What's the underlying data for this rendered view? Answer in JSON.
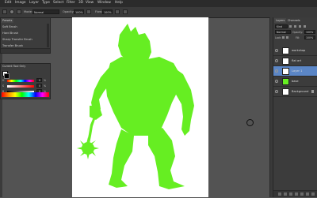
{
  "menubar": {
    "items": [
      "Edit",
      "Image",
      "Layer",
      "Type",
      "Select",
      "Filter",
      "3D",
      "View",
      "Window",
      "Help"
    ]
  },
  "options": {
    "mode_label": "Mode:",
    "mode_value": "Normal",
    "opacity_label": "Opacity:",
    "opacity_value": "100%",
    "flow_label": "Flow:",
    "flow_value": "100%"
  },
  "presets": {
    "tab_label": "Presets",
    "items": [
      "Soft Brush",
      "Hard Brush",
      "Sharp Transfer Brush",
      "Transfer Brush"
    ]
  },
  "colorpanel": {
    "tab_label": "Current Tool Only",
    "sliders": [
      {
        "label": "H",
        "value": "0",
        "unit": "%"
      },
      {
        "label": "S",
        "value": "0",
        "unit": "%"
      },
      {
        "label": "B",
        "value": "0",
        "unit": "%"
      }
    ]
  },
  "layers": {
    "tabs": [
      "Layers",
      "Channels"
    ],
    "kind_label": "Kind",
    "blend_mode": "Normal",
    "opacity_label": "Opacity:",
    "opacity_value": "100%",
    "lock_label": "Lock:",
    "fill_label": "Fill:",
    "fill_value": "100%",
    "items": [
      {
        "name": "workshop",
        "visible": true,
        "active": false,
        "thumb_color": "#ffffff"
      },
      {
        "name": "flat art",
        "visible": true,
        "active": false,
        "thumb_color": "#ffffff"
      },
      {
        "name": "Layer 1",
        "visible": true,
        "active": true,
        "thumb_color": "#ffffff"
      },
      {
        "name": "base",
        "visible": true,
        "active": false,
        "thumb_color": "#66ee22"
      },
      {
        "name": "Background",
        "visible": true,
        "active": false,
        "thumb_color": "#ffffff"
      }
    ]
  },
  "colors": {
    "fill": "#66ee22",
    "canvas": "#ffffff",
    "workspace": "#535353",
    "active_layer": "#5b86c6"
  }
}
